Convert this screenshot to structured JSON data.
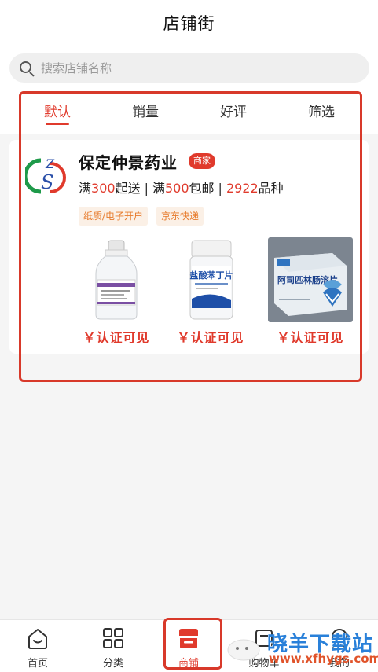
{
  "header": {
    "title": "店铺街"
  },
  "search": {
    "placeholder": "搜索店铺名称"
  },
  "tabs": [
    {
      "label": "默认",
      "active": true
    },
    {
      "label": "销量",
      "active": false
    },
    {
      "label": "好评",
      "active": false
    },
    {
      "label": "筛选",
      "active": false
    }
  ],
  "store": {
    "name": "保定仲景药业",
    "badge": "商家",
    "min_order_prefix": "满",
    "min_order_value": "300",
    "min_order_suffix": "起送",
    "free_ship_prefix": "满",
    "free_ship_value": "500",
    "free_ship_suffix": "包邮",
    "product_count_value": "2922",
    "product_count_suffix": "品种",
    "separator": "|",
    "tags": [
      "纸质/电子开户",
      "京东快递"
    ],
    "products": [
      {
        "price": "￥认证可见",
        "image": "infusion-bottle"
      },
      {
        "price": "￥认证可见",
        "image": "pill-bottle",
        "image_label": "盐酸苯丁片"
      },
      {
        "price": "￥认证可见",
        "image": "medicine-box",
        "image_label": "阿司匹林肠溶片"
      }
    ]
  },
  "bottom_nav": [
    {
      "label": "首页",
      "icon": "home-icon",
      "active": false
    },
    {
      "label": "分类",
      "icon": "category-grid-icon",
      "active": false
    },
    {
      "label": "商铺",
      "icon": "shop-icon",
      "active": true
    },
    {
      "label": "购物车",
      "icon": "cart-icon",
      "active": false
    },
    {
      "label": "我的",
      "icon": "profile-icon",
      "active": false
    }
  ],
  "watermark": {
    "text": "晓羊下载站",
    "url": "www.xfhygs.com"
  },
  "colors": {
    "accent": "#e03a2c",
    "tag_bg": "#fbf0e6",
    "tag_text": "#e77b2c",
    "highlight_border": "#d8392a"
  }
}
